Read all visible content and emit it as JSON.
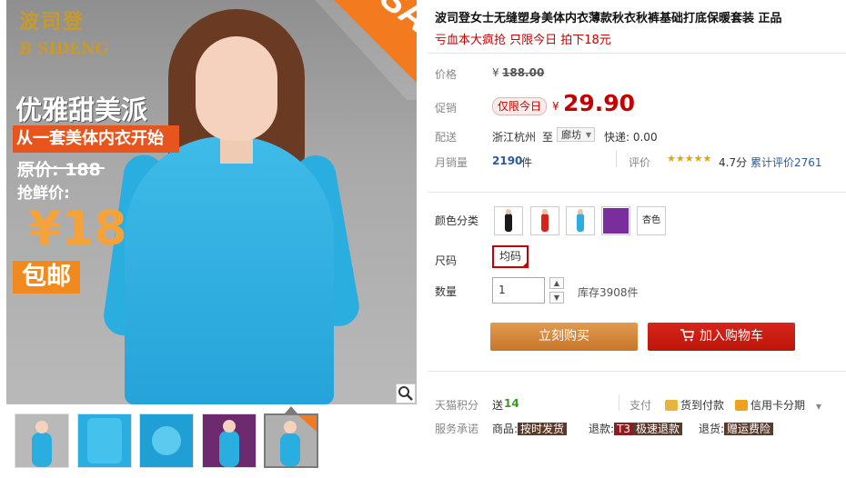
{
  "gallery": {
    "logo_cn": "波司登",
    "logo_en": "B SIDENG",
    "sale_label": "SALE",
    "promo_line1": "优雅甜美派",
    "promo_line2": "从一套美体内衣开始",
    "promo_original": "原价: 188",
    "promo_deal_label": "抢鲜价:",
    "promo_price": "¥18",
    "promo_shipping": "包邮",
    "zoom_icon": "magnifier-icon",
    "thumbnails": [
      "thumb-1",
      "thumb-2",
      "thumb-3",
      "thumb-4",
      "thumb-5"
    ]
  },
  "product": {
    "title": "波司登女士无缝塑身美体内衣薄款秋衣秋裤基础打底保暖套装 正品",
    "subtitle": "亏血本大疯抢 只限今日 拍下18元"
  },
  "price_block": {
    "list_price_label": "价格",
    "list_price_currency": "¥",
    "list_price": "188.00",
    "promo_label": "促销",
    "promo_badge": "仅限今日",
    "promo_currency": "¥",
    "promo_price": "29.90",
    "delivery_label": "配送",
    "delivery_from": "浙江杭州",
    "delivery_to_word": "至",
    "delivery_to": "廊坊",
    "delivery_fee": "快递: 0.00",
    "monthly_sales_label": "月销量",
    "monthly_sales_value": "2190",
    "monthly_sales_unit": "件",
    "rating_label": "评价",
    "rating_stars": "★★★★★",
    "rating_score": "4.7分",
    "review_count": "累计评价2761"
  },
  "options": {
    "color_label": "颜色分类",
    "colors": [
      {
        "name": "black-outfit",
        "color": "#1a1a1a"
      },
      {
        "name": "red-outfit",
        "color": "#d8231d"
      },
      {
        "name": "blue-outfit",
        "color": "#2aaee0"
      },
      {
        "name": "purple-outfit",
        "color": "#7a2d9c"
      }
    ],
    "color_text_option": "杏色",
    "size_label": "尺码",
    "size_value": "均码",
    "qty_label": "数量",
    "qty_value": "1",
    "stock": "库存3908件"
  },
  "actions": {
    "buy_now": "立刻购买",
    "add_to_cart": "加入购物车"
  },
  "footer": {
    "points_label": "天猫积分",
    "points_text": "送",
    "points_value": "14",
    "pay_label": "支付",
    "pay_cod": "货到付款",
    "pay_credit": "信用卡分期",
    "service_label": "服务承诺",
    "service_goods_label": "商品:",
    "service_goods_tag": "按时发货",
    "service_refund_label": "退款:",
    "service_refund_prefix": "T3",
    "service_refund_tag": "极速退款",
    "service_return_label": "退货:",
    "service_return_tag": "赠运费险"
  },
  "colors": {
    "accent_red": "#c40000",
    "buy_orange": "#d98a3c",
    "cart_red": "#c8150b"
  }
}
